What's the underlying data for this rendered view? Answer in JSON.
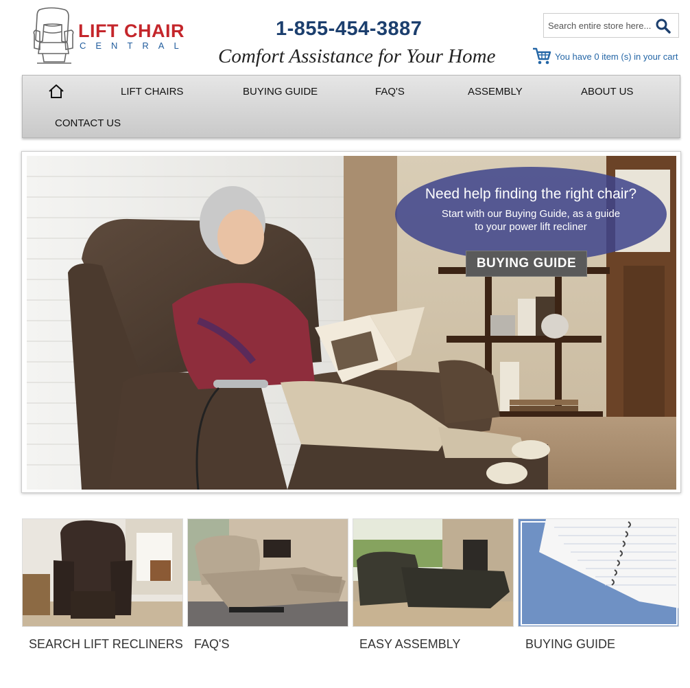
{
  "header": {
    "logo_line1": "LIFT CHAIR",
    "logo_line2": "CENTRAL",
    "phone": "1-855-454-3887",
    "tagline": "Comfort Assistance for Your Home",
    "search_placeholder": "Search entire store here...",
    "cart_text": "You have 0 item (s) in your cart"
  },
  "nav": {
    "items": [
      "LIFT CHAIRS",
      "BUYING GUIDE",
      "FAQ'S",
      "ASSEMBLY",
      "ABOUT US",
      "CONTACT US"
    ]
  },
  "hero": {
    "callout_title": "Need help finding the right chair?",
    "callout_line1": "Start with our Buying Guide, as a guide",
    "callout_line2": "to your power lift recliner",
    "button_label": "BUYING GUIDE"
  },
  "tiles": [
    {
      "label": "SEARCH LIFT RECLINERS"
    },
    {
      "label": "FAQ'S"
    },
    {
      "label": "EASY ASSEMBLY"
    },
    {
      "label": "BUYING GUIDE"
    }
  ],
  "colors": {
    "brand_red": "#c4262b",
    "brand_blue": "#1f5b9c",
    "phone_navy": "#1c3f6e",
    "link_blue": "#2466a6",
    "callout_bg": "#3e448c"
  }
}
